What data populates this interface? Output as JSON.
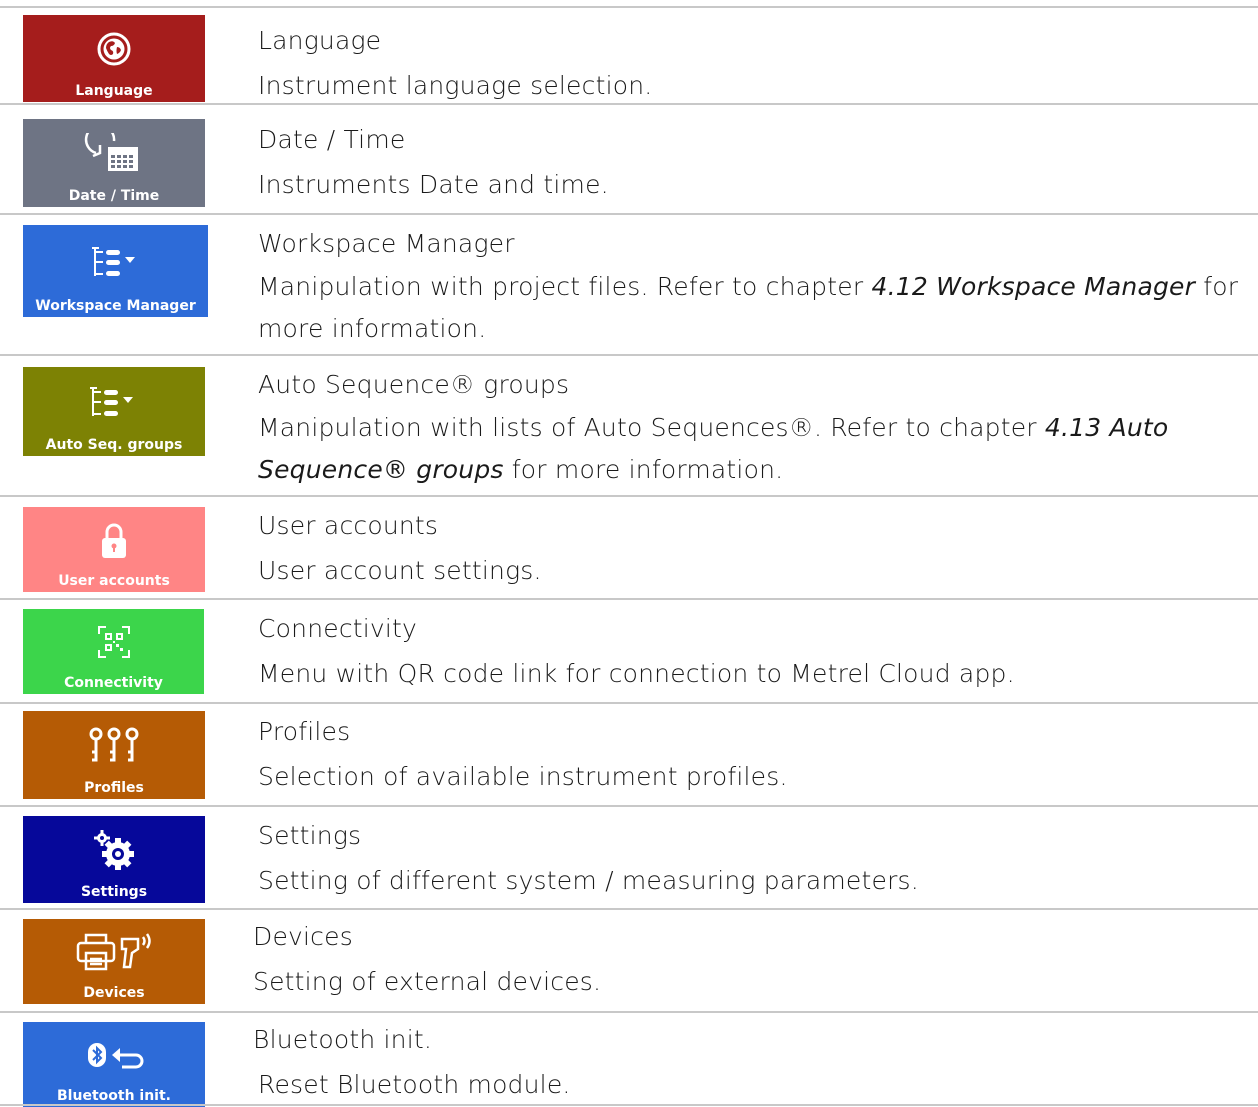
{
  "colors": {
    "language": "#a51d1c",
    "date_time": "#6e7484",
    "workspace_manager": "#2d6bd8",
    "auto_seq_groups": "#7d8204",
    "user_accounts": "#ff8585",
    "connectivity": "#3cd54b",
    "profiles": "#b55b05",
    "settings": "#06089a",
    "devices": "#b55b05",
    "bluetooth_init": "#2d6bd8",
    "divider": "#c8c8c8"
  },
  "items": [
    {
      "icon": "globe-icon",
      "tile_label": "Language",
      "title": "Language",
      "description": "Instrument language selection."
    },
    {
      "icon": "clock-calendar-icon",
      "tile_label": "Date / Time",
      "title": "Date / Time",
      "description": "Instruments Date and time."
    },
    {
      "icon": "tree-list-icon",
      "tile_label": "Workspace Manager",
      "title": "Workspace Manager",
      "description_before": "Manipulation with project files. Refer to chapter ",
      "description_ref": "4.12 Workspace Manager",
      "description_after": " for more information."
    },
    {
      "icon": "tree-list-icon",
      "tile_label": "Auto Seq. groups",
      "title": "Auto Sequence® groups",
      "description_before": "Manipulation with lists of Auto Sequences®. Refer to chapter ",
      "description_ref": "4.13 Auto Sequence® groups",
      "description_after": " for more information."
    },
    {
      "icon": "lock-icon",
      "tile_label": "User accounts",
      "title": "User accounts",
      "description": "User account settings."
    },
    {
      "icon": "qr-code-icon",
      "tile_label": "Connectivity",
      "title": "Connectivity",
      "description": "Menu with QR code link for connection to Metrel Cloud app."
    },
    {
      "icon": "keys-icon",
      "tile_label": "Profiles",
      "title": "Profiles",
      "description": "Selection of available instrument profiles."
    },
    {
      "icon": "gears-icon",
      "tile_label": "Settings",
      "title": "Settings",
      "description": "Setting of different system / measuring parameters."
    },
    {
      "icon": "printer-scanner-icon",
      "tile_label": "Devices",
      "title": "Devices",
      "description": "Setting of external devices."
    },
    {
      "icon": "bluetooth-reset-icon",
      "tile_label": "Bluetooth init.",
      "title": "Bluetooth init.",
      "description": "Reset Bluetooth module."
    }
  ]
}
